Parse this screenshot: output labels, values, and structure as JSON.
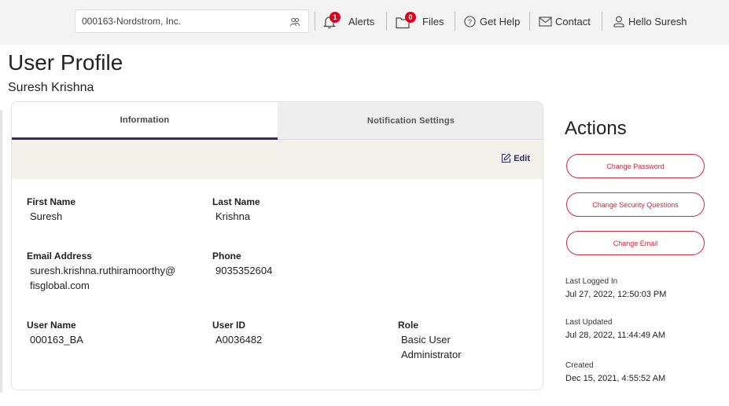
{
  "header": {
    "company": "000163-Nordstrom, Inc.",
    "alerts_label": "Alerts",
    "alerts_count": "1",
    "files_label": "Files",
    "files_count": "0",
    "help_label": "Get Help",
    "contact_label": "Contact",
    "user_greeting": "Hello Suresh"
  },
  "page": {
    "title": "User Profile",
    "subtitle": "Suresh Krishna"
  },
  "tabs": [
    {
      "label": "Information",
      "active": true
    },
    {
      "label": "Notification Settings",
      "active": false
    }
  ],
  "edit_label": "Edit",
  "fields": {
    "first_name": {
      "label": "First Name",
      "value": "Suresh"
    },
    "last_name": {
      "label": "Last Name",
      "value": "Krishna"
    },
    "email": {
      "label": "Email Address",
      "line1": "suresh.krishna.ruthiramoorthy@",
      "line2": "fisglobal.com"
    },
    "phone": {
      "label": "Phone",
      "value": "9035352604"
    },
    "user_name": {
      "label": "User Name",
      "value": "000163_BA"
    },
    "user_id": {
      "label": "User ID",
      "value": "A0036482"
    },
    "role": {
      "label": "Role",
      "line1": "Basic User",
      "line2": "Administrator"
    }
  },
  "actions": {
    "title": "Actions",
    "change_password": "Change Password",
    "change_security": "Change Security Questions",
    "change_email": "Change Email"
  },
  "meta": {
    "last_logged_in_label": "Last Logged In",
    "last_logged_in_value": "Jul 27, 2022, 12:50:03 PM",
    "last_updated_label": "Last Updated",
    "last_updated_value": "Jul 28, 2022, 11:44:49 AM",
    "created_label": "Created",
    "created_value": "Dec 15, 2021, 4:55:52 AM"
  },
  "colors": {
    "accent": "#2d2d6a",
    "danger": "#d7263d",
    "badge": "#e0001b",
    "edit_band": "#f4f0ea"
  }
}
